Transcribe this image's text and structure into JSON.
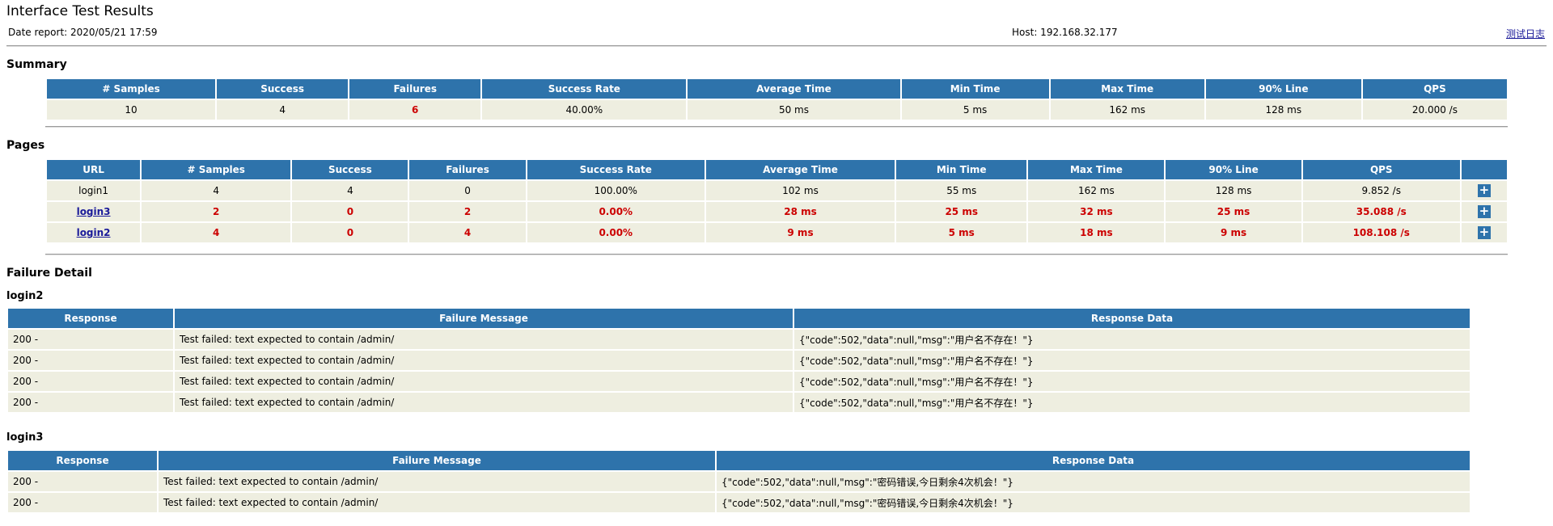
{
  "header": {
    "title": "Interface Test Results",
    "date_report": "Date report: 2020/05/21 17:59",
    "host": "Host: 192.168.32.177",
    "log_link": "测试日志"
  },
  "summary": {
    "title": "Summary",
    "columns": [
      "# Samples",
      "Success",
      "Failures",
      "Success Rate",
      "Average Time",
      "Min Time",
      "Max Time",
      "90% Line",
      "QPS"
    ],
    "row": [
      "10",
      "4",
      "6",
      "40.00%",
      "50 ms",
      "5 ms",
      "162 ms",
      "128 ms",
      "20.000 /s"
    ]
  },
  "pages": {
    "title": "Pages",
    "columns": [
      "URL",
      "# Samples",
      "Success",
      "Failures",
      "Success Rate",
      "Average Time",
      "Min Time",
      "Max Time",
      "90% Line",
      "QPS"
    ],
    "rows": [
      [
        "login1",
        "4",
        "4",
        "0",
        "100.00%",
        "102 ms",
        "55 ms",
        "162 ms",
        "128 ms",
        "9.852 /s"
      ],
      [
        "login3",
        "2",
        "0",
        "2",
        "0.00%",
        "28 ms",
        "25 ms",
        "32 ms",
        "25 ms",
        "35.088 /s"
      ],
      [
        "login2",
        "4",
        "0",
        "4",
        "0.00%",
        "9 ms",
        "5 ms",
        "18 ms",
        "9 ms",
        "108.108 /s"
      ]
    ],
    "expand_symbol": "+"
  },
  "failure_detail": {
    "title": "Failure Detail",
    "groups": [
      {
        "name": "login2",
        "columns": [
          "Response",
          "Failure Message",
          "Response Data"
        ],
        "rows": [
          [
            "200 -",
            "Test failed: text expected to contain /admin/",
            "{\"code\":502,\"data\":null,\"msg\":\"用户名不存在！\"}"
          ],
          [
            "200 -",
            "Test failed: text expected to contain /admin/",
            "{\"code\":502,\"data\":null,\"msg\":\"用户名不存在！\"}"
          ],
          [
            "200 -",
            "Test failed: text expected to contain /admin/",
            "{\"code\":502,\"data\":null,\"msg\":\"用户名不存在！\"}"
          ],
          [
            "200 -",
            "Test failed: text expected to contain /admin/",
            "{\"code\":502,\"data\":null,\"msg\":\"用户名不存在！\"}"
          ]
        ]
      },
      {
        "name": "login3",
        "columns": [
          "Response",
          "Failure Message",
          "Response Data"
        ],
        "rows": [
          [
            "200 -",
            "Test failed: text expected to contain /admin/",
            "{\"code\":502,\"data\":null,\"msg\":\"密码错误,今日剩余4次机会！\"}"
          ],
          [
            "200 -",
            "Test failed: text expected to contain /admin/",
            "{\"code\":502,\"data\":null,\"msg\":\"密码错误,今日剩余4次机会！\"}"
          ]
        ]
      }
    ]
  },
  "colors": {
    "header_bg": "#2e73ab",
    "cell_bg": "#eeeee0",
    "failure_text": "#cc0000",
    "link": "#1a1a99"
  }
}
